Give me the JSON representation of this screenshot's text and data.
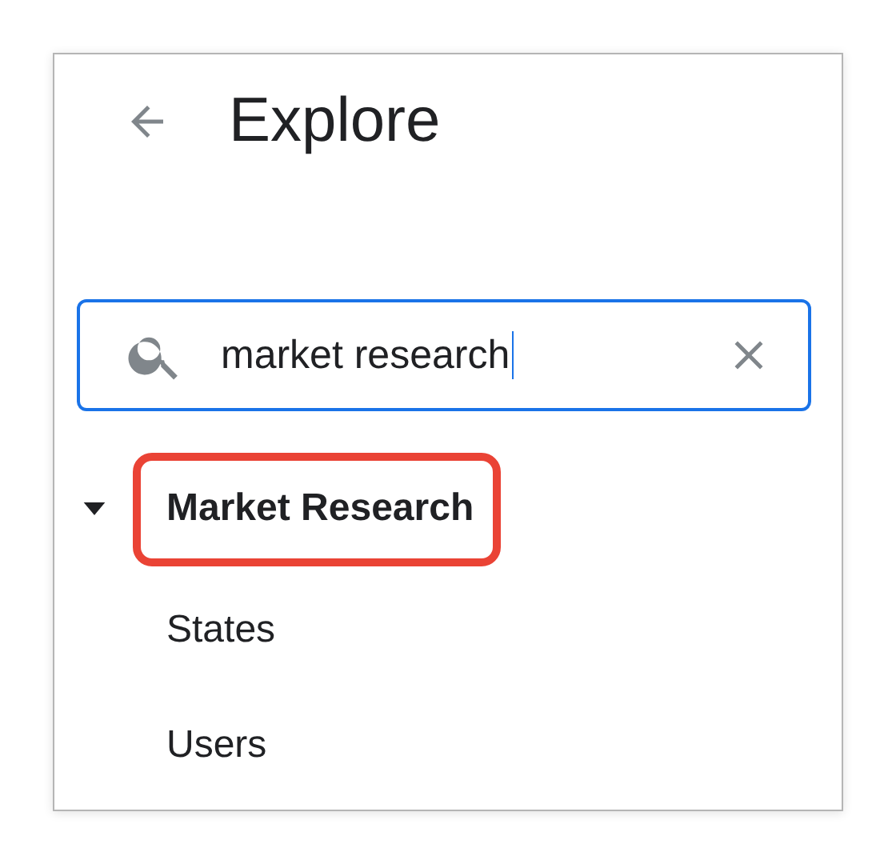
{
  "header": {
    "title": "Explore"
  },
  "search": {
    "value": "market research"
  },
  "tree": [
    {
      "label": "Market Research",
      "expanded": true,
      "highlighted": true,
      "children": [
        {
          "label": "States"
        },
        {
          "label": "Users"
        }
      ]
    }
  ]
}
